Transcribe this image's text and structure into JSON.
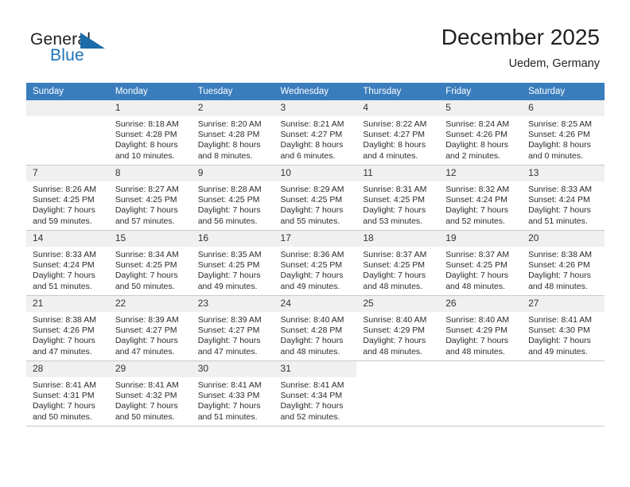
{
  "brand": {
    "name_part1": "General",
    "name_part2": "Blue",
    "accent_color": "#1b6ca8"
  },
  "header": {
    "month_title": "December 2025",
    "location": "Uedem, Germany"
  },
  "calendar": {
    "header_bg": "#3a7dbd",
    "weekday_headers": [
      "Sunday",
      "Monday",
      "Tuesday",
      "Wednesday",
      "Thursday",
      "Friday",
      "Saturday"
    ],
    "weeks": [
      [
        {
          "day": "",
          "sunrise": "",
          "sunset": "",
          "daylight_line1": "",
          "daylight_line2": "",
          "empty": true
        },
        {
          "day": "1",
          "sunrise": "Sunrise: 8:18 AM",
          "sunset": "Sunset: 4:28 PM",
          "daylight_line1": "Daylight: 8 hours",
          "daylight_line2": "and 10 minutes.",
          "empty": false
        },
        {
          "day": "2",
          "sunrise": "Sunrise: 8:20 AM",
          "sunset": "Sunset: 4:28 PM",
          "daylight_line1": "Daylight: 8 hours",
          "daylight_line2": "and 8 minutes.",
          "empty": false
        },
        {
          "day": "3",
          "sunrise": "Sunrise: 8:21 AM",
          "sunset": "Sunset: 4:27 PM",
          "daylight_line1": "Daylight: 8 hours",
          "daylight_line2": "and 6 minutes.",
          "empty": false
        },
        {
          "day": "4",
          "sunrise": "Sunrise: 8:22 AM",
          "sunset": "Sunset: 4:27 PM",
          "daylight_line1": "Daylight: 8 hours",
          "daylight_line2": "and 4 minutes.",
          "empty": false
        },
        {
          "day": "5",
          "sunrise": "Sunrise: 8:24 AM",
          "sunset": "Sunset: 4:26 PM",
          "daylight_line1": "Daylight: 8 hours",
          "daylight_line2": "and 2 minutes.",
          "empty": false
        },
        {
          "day": "6",
          "sunrise": "Sunrise: 8:25 AM",
          "sunset": "Sunset: 4:26 PM",
          "daylight_line1": "Daylight: 8 hours",
          "daylight_line2": "and 0 minutes.",
          "empty": false
        }
      ],
      [
        {
          "day": "7",
          "sunrise": "Sunrise: 8:26 AM",
          "sunset": "Sunset: 4:25 PM",
          "daylight_line1": "Daylight: 7 hours",
          "daylight_line2": "and 59 minutes.",
          "empty": false
        },
        {
          "day": "8",
          "sunrise": "Sunrise: 8:27 AM",
          "sunset": "Sunset: 4:25 PM",
          "daylight_line1": "Daylight: 7 hours",
          "daylight_line2": "and 57 minutes.",
          "empty": false
        },
        {
          "day": "9",
          "sunrise": "Sunrise: 8:28 AM",
          "sunset": "Sunset: 4:25 PM",
          "daylight_line1": "Daylight: 7 hours",
          "daylight_line2": "and 56 minutes.",
          "empty": false
        },
        {
          "day": "10",
          "sunrise": "Sunrise: 8:29 AM",
          "sunset": "Sunset: 4:25 PM",
          "daylight_line1": "Daylight: 7 hours",
          "daylight_line2": "and 55 minutes.",
          "empty": false
        },
        {
          "day": "11",
          "sunrise": "Sunrise: 8:31 AM",
          "sunset": "Sunset: 4:25 PM",
          "daylight_line1": "Daylight: 7 hours",
          "daylight_line2": "and 53 minutes.",
          "empty": false
        },
        {
          "day": "12",
          "sunrise": "Sunrise: 8:32 AM",
          "sunset": "Sunset: 4:24 PM",
          "daylight_line1": "Daylight: 7 hours",
          "daylight_line2": "and 52 minutes.",
          "empty": false
        },
        {
          "day": "13",
          "sunrise": "Sunrise: 8:33 AM",
          "sunset": "Sunset: 4:24 PM",
          "daylight_line1": "Daylight: 7 hours",
          "daylight_line2": "and 51 minutes.",
          "empty": false
        }
      ],
      [
        {
          "day": "14",
          "sunrise": "Sunrise: 8:33 AM",
          "sunset": "Sunset: 4:24 PM",
          "daylight_line1": "Daylight: 7 hours",
          "daylight_line2": "and 51 minutes.",
          "empty": false
        },
        {
          "day": "15",
          "sunrise": "Sunrise: 8:34 AM",
          "sunset": "Sunset: 4:25 PM",
          "daylight_line1": "Daylight: 7 hours",
          "daylight_line2": "and 50 minutes.",
          "empty": false
        },
        {
          "day": "16",
          "sunrise": "Sunrise: 8:35 AM",
          "sunset": "Sunset: 4:25 PM",
          "daylight_line1": "Daylight: 7 hours",
          "daylight_line2": "and 49 minutes.",
          "empty": false
        },
        {
          "day": "17",
          "sunrise": "Sunrise: 8:36 AM",
          "sunset": "Sunset: 4:25 PM",
          "daylight_line1": "Daylight: 7 hours",
          "daylight_line2": "and 49 minutes.",
          "empty": false
        },
        {
          "day": "18",
          "sunrise": "Sunrise: 8:37 AM",
          "sunset": "Sunset: 4:25 PM",
          "daylight_line1": "Daylight: 7 hours",
          "daylight_line2": "and 48 minutes.",
          "empty": false
        },
        {
          "day": "19",
          "sunrise": "Sunrise: 8:37 AM",
          "sunset": "Sunset: 4:25 PM",
          "daylight_line1": "Daylight: 7 hours",
          "daylight_line2": "and 48 minutes.",
          "empty": false
        },
        {
          "day": "20",
          "sunrise": "Sunrise: 8:38 AM",
          "sunset": "Sunset: 4:26 PM",
          "daylight_line1": "Daylight: 7 hours",
          "daylight_line2": "and 48 minutes.",
          "empty": false
        }
      ],
      [
        {
          "day": "21",
          "sunrise": "Sunrise: 8:38 AM",
          "sunset": "Sunset: 4:26 PM",
          "daylight_line1": "Daylight: 7 hours",
          "daylight_line2": "and 47 minutes.",
          "empty": false
        },
        {
          "day": "22",
          "sunrise": "Sunrise: 8:39 AM",
          "sunset": "Sunset: 4:27 PM",
          "daylight_line1": "Daylight: 7 hours",
          "daylight_line2": "and 47 minutes.",
          "empty": false
        },
        {
          "day": "23",
          "sunrise": "Sunrise: 8:39 AM",
          "sunset": "Sunset: 4:27 PM",
          "daylight_line1": "Daylight: 7 hours",
          "daylight_line2": "and 47 minutes.",
          "empty": false
        },
        {
          "day": "24",
          "sunrise": "Sunrise: 8:40 AM",
          "sunset": "Sunset: 4:28 PM",
          "daylight_line1": "Daylight: 7 hours",
          "daylight_line2": "and 48 minutes.",
          "empty": false
        },
        {
          "day": "25",
          "sunrise": "Sunrise: 8:40 AM",
          "sunset": "Sunset: 4:29 PM",
          "daylight_line1": "Daylight: 7 hours",
          "daylight_line2": "and 48 minutes.",
          "empty": false
        },
        {
          "day": "26",
          "sunrise": "Sunrise: 8:40 AM",
          "sunset": "Sunset: 4:29 PM",
          "daylight_line1": "Daylight: 7 hours",
          "daylight_line2": "and 48 minutes.",
          "empty": false
        },
        {
          "day": "27",
          "sunrise": "Sunrise: 8:41 AM",
          "sunset": "Sunset: 4:30 PM",
          "daylight_line1": "Daylight: 7 hours",
          "daylight_line2": "and 49 minutes.",
          "empty": false
        }
      ],
      [
        {
          "day": "28",
          "sunrise": "Sunrise: 8:41 AM",
          "sunset": "Sunset: 4:31 PM",
          "daylight_line1": "Daylight: 7 hours",
          "daylight_line2": "and 50 minutes.",
          "empty": false
        },
        {
          "day": "29",
          "sunrise": "Sunrise: 8:41 AM",
          "sunset": "Sunset: 4:32 PM",
          "daylight_line1": "Daylight: 7 hours",
          "daylight_line2": "and 50 minutes.",
          "empty": false
        },
        {
          "day": "30",
          "sunrise": "Sunrise: 8:41 AM",
          "sunset": "Sunset: 4:33 PM",
          "daylight_line1": "Daylight: 7 hours",
          "daylight_line2": "and 51 minutes.",
          "empty": false
        },
        {
          "day": "31",
          "sunrise": "Sunrise: 8:41 AM",
          "sunset": "Sunset: 4:34 PM",
          "daylight_line1": "Daylight: 7 hours",
          "daylight_line2": "and 52 minutes.",
          "empty": false
        },
        {
          "day": "",
          "sunrise": "",
          "sunset": "",
          "daylight_line1": "",
          "daylight_line2": "",
          "empty": true,
          "blank": true
        },
        {
          "day": "",
          "sunrise": "",
          "sunset": "",
          "daylight_line1": "",
          "daylight_line2": "",
          "empty": true,
          "blank": true
        },
        {
          "day": "",
          "sunrise": "",
          "sunset": "",
          "daylight_line1": "",
          "daylight_line2": "",
          "empty": true,
          "blank": true
        }
      ]
    ]
  }
}
